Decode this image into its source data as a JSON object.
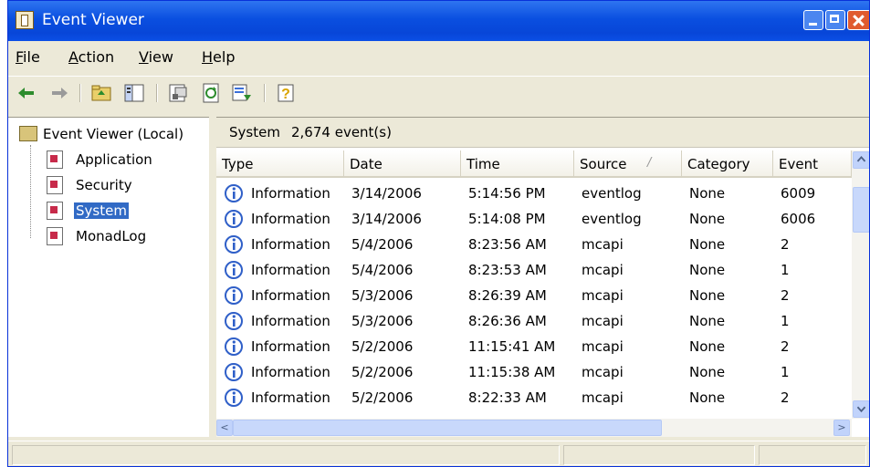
{
  "window": {
    "title": "Event Viewer"
  },
  "menu": [
    {
      "underline": "F",
      "rest": "ile"
    },
    {
      "underline": "A",
      "rest": "ction"
    },
    {
      "underline": "V",
      "rest": "iew"
    },
    {
      "underline": "H",
      "rest": "elp"
    }
  ],
  "toolbar": [
    "back-arrow-icon",
    "forward-arrow-icon",
    "up-folder-icon",
    "show-hide-tree-icon",
    "properties-icon",
    "refresh-icon",
    "export-list-icon",
    "help-icon"
  ],
  "tree": {
    "root": "Event Viewer (Local)",
    "items": [
      {
        "label": "Application",
        "selected": false
      },
      {
        "label": "Security",
        "selected": false
      },
      {
        "label": "System",
        "selected": true
      },
      {
        "label": "MonadLog",
        "selected": false
      }
    ]
  },
  "list": {
    "title": "System",
    "count": "2,674 event(s)",
    "columns": [
      "Type",
      "Date",
      "Time",
      "Source",
      "Category",
      "Event"
    ],
    "sort_indicator": "/",
    "rows": [
      {
        "type": "Information",
        "date": "3/14/2006",
        "time": "5:14:56 PM",
        "source": "eventlog",
        "category": "None",
        "event": "6009"
      },
      {
        "type": "Information",
        "date": "3/14/2006",
        "time": "5:14:08 PM",
        "source": "eventlog",
        "category": "None",
        "event": "6006"
      },
      {
        "type": "Information",
        "date": "5/4/2006",
        "time": "8:23:56 AM",
        "source": "mcapi",
        "category": "None",
        "event": "2"
      },
      {
        "type": "Information",
        "date": "5/4/2006",
        "time": "8:23:53 AM",
        "source": "mcapi",
        "category": "None",
        "event": "1"
      },
      {
        "type": "Information",
        "date": "5/3/2006",
        "time": "8:26:39 AM",
        "source": "mcapi",
        "category": "None",
        "event": "2"
      },
      {
        "type": "Information",
        "date": "5/3/2006",
        "time": "8:26:36 AM",
        "source": "mcapi",
        "category": "None",
        "event": "1"
      },
      {
        "type": "Information",
        "date": "5/2/2006",
        "time": "11:15:41 AM",
        "source": "mcapi",
        "category": "None",
        "event": "2"
      },
      {
        "type": "Information",
        "date": "5/2/2006",
        "time": "11:15:38 AM",
        "source": "mcapi",
        "category": "None",
        "event": "1"
      },
      {
        "type": "Information",
        "date": "5/2/2006",
        "time": "8:22:33 AM",
        "source": "mcapi",
        "category": "None",
        "event": "2"
      }
    ]
  },
  "colors": {
    "titlebar": "#0a4fe0",
    "selection": "#316ac5",
    "info_icon": "#2f5fc8"
  }
}
